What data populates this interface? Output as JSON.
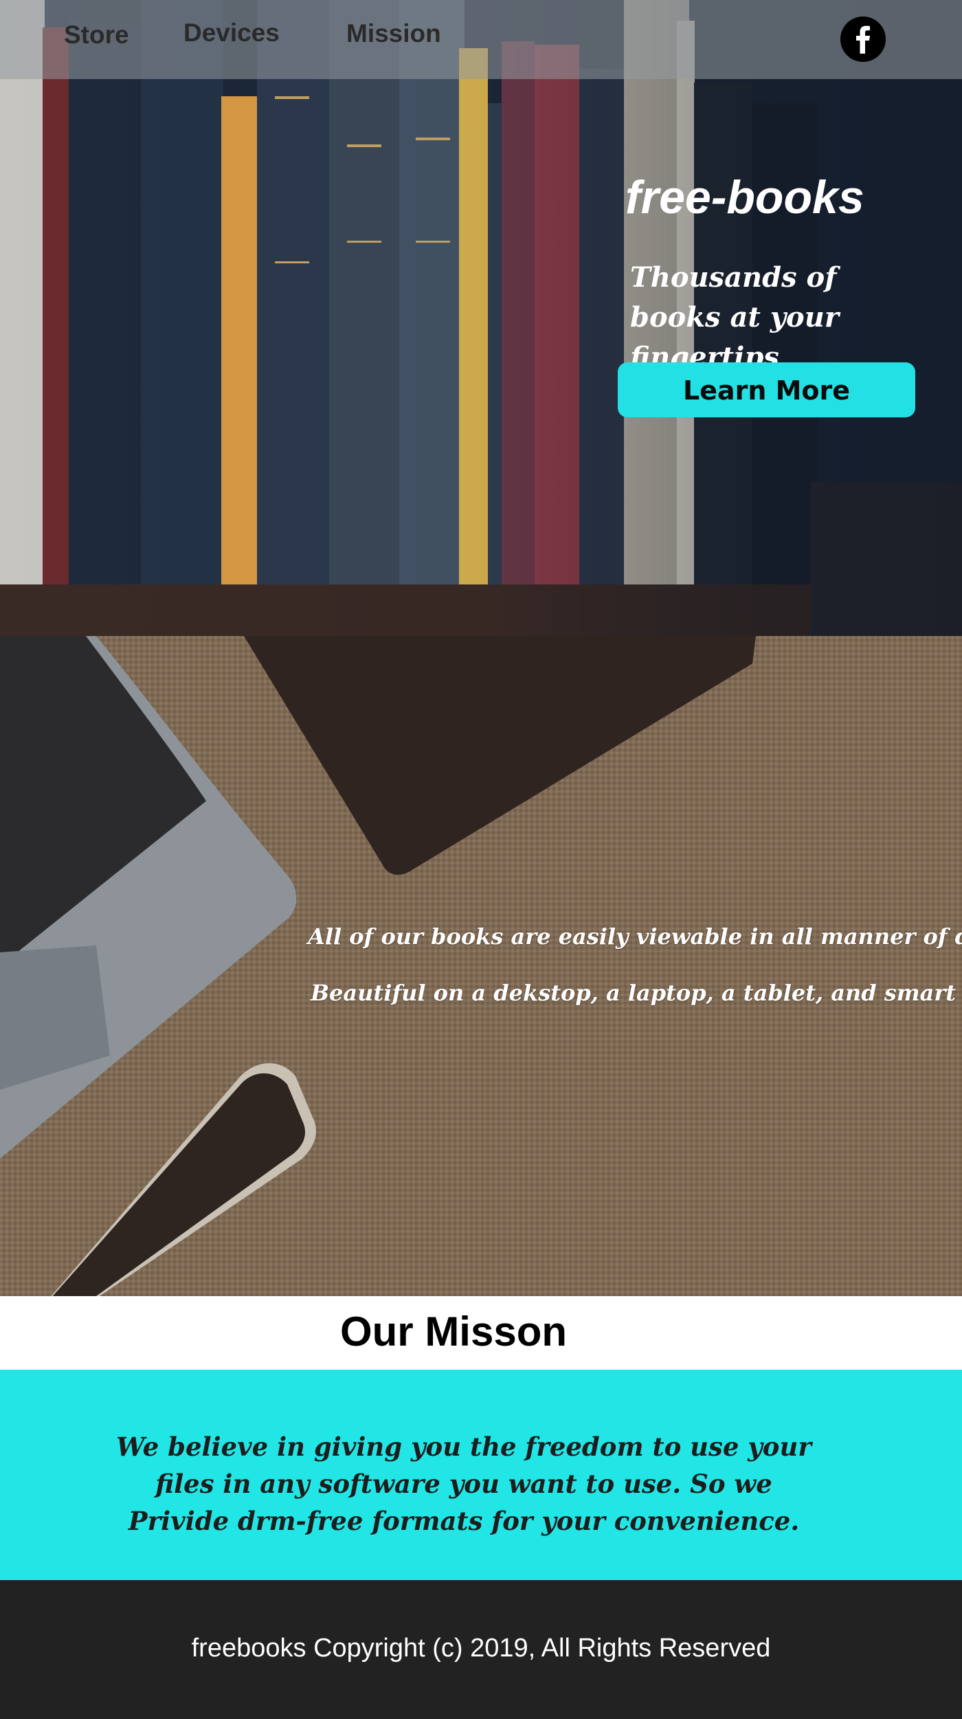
{
  "nav": {
    "items": [
      {
        "label": "Store"
      },
      {
        "label": "Devices"
      },
      {
        "label": "Mission"
      }
    ],
    "social_icon": "facebook-icon"
  },
  "hero": {
    "title": "free-books",
    "tagline": "Thousands of books at your fingertips",
    "cta_label": "Learn More"
  },
  "devices": {
    "line1": "All of our books are easily viewable in all manner of devices.",
    "line2": "Beautiful on a dekstop, a laptop, a tablet, and smart phone."
  },
  "mission": {
    "heading": "Our Misson",
    "text": "We believe in giving you the freedom to use your files in any software you want to use. So we Privide drm-free formats for your convenience."
  },
  "footer": {
    "text": "freebooks Copyright (c) 2019, All Rights Reserved"
  },
  "colors": {
    "accent": "#22e0e3",
    "footer_bg": "#222222",
    "navbar_overlay": "#969ba0"
  }
}
